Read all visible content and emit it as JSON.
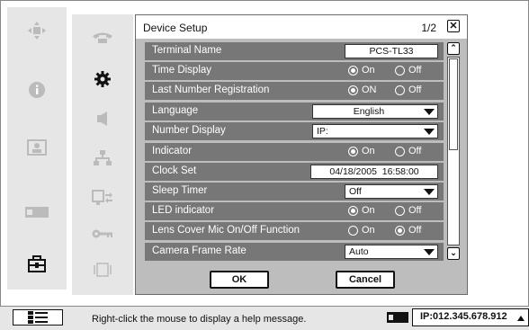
{
  "dialog": {
    "title": "Device Setup",
    "page": "1/2",
    "close_glyph": "✕",
    "rows": [
      {
        "label": "Terminal Name",
        "type": "text",
        "value": "PCS-TL33"
      },
      {
        "label": "Time Display",
        "type": "radio",
        "options": [
          "On",
          "Off"
        ],
        "selected": "On"
      },
      {
        "label": "Last Number Registration",
        "type": "radio",
        "options": [
          "ON",
          "Off"
        ],
        "selected": "ON"
      },
      {
        "label": "Language",
        "type": "dropdown",
        "value": "English"
      },
      {
        "label": "Number Display",
        "type": "dropdown",
        "value": "IP:"
      },
      {
        "label": "Indicator",
        "type": "radio",
        "options": [
          "On",
          "Off"
        ],
        "selected": "On"
      },
      {
        "label": "Clock Set",
        "type": "text",
        "value": "04/18/2005  16:58:00"
      },
      {
        "label": "Sleep Timer",
        "type": "dropdown",
        "value": "Off"
      },
      {
        "label": "LED indicator",
        "type": "radio",
        "options": [
          "On",
          "Off"
        ],
        "selected": "On"
      },
      {
        "label": "Lens Cover Mic On/Off Function",
        "type": "radio",
        "options": [
          "On",
          "Off"
        ],
        "selected": "Off"
      },
      {
        "label": "Camera Frame Rate",
        "type": "dropdown",
        "value": "Auto"
      }
    ],
    "ok_label": "OK",
    "cancel_label": "Cancel",
    "scroll_up_glyph": "⌃",
    "scroll_down_glyph": "⌄"
  },
  "left_icons": [
    "camera-move-icon",
    "info-icon",
    "picture-icon",
    "card-icon",
    "toolbox-icon"
  ],
  "mid_icons": [
    "phone-icon",
    "gear-icon",
    "speaker-icon",
    "network-icon",
    "monitor-arrow-icon",
    "key-icon",
    "frame-icon"
  ],
  "statusbar": {
    "help_text": "Right-click the mouse to display a help message.",
    "ip": "IP:012.345.678.912"
  },
  "colors": {
    "row_bg": "#777777",
    "dialog_bg": "#bdbdbd",
    "panel_bg": "#e6e6e6"
  }
}
